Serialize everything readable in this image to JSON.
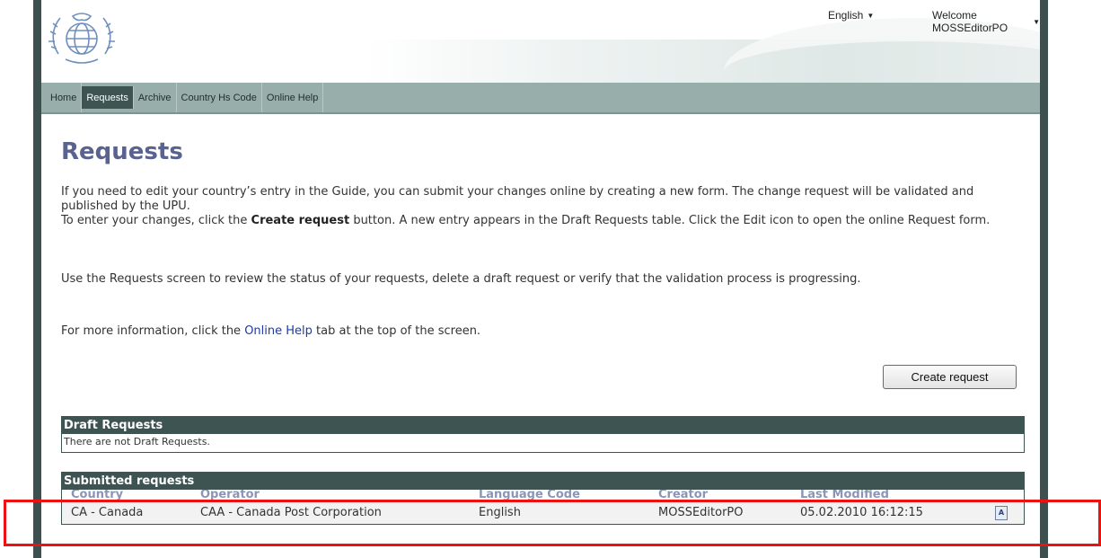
{
  "header": {
    "language": "English",
    "welcome": "Welcome MOSSEditorPO"
  },
  "nav": {
    "items": [
      {
        "label": "Home"
      },
      {
        "label": "Requests"
      },
      {
        "label": "Archive"
      },
      {
        "label": "Country Hs Code"
      },
      {
        "label": "Online Help"
      }
    ],
    "active": "Requests"
  },
  "page": {
    "title": "Requests",
    "para1_a": "If you need to edit your country’s entry in the Guide, you can submit your changes online by creating a new form. The change request will be validated and published by the UPU.",
    "para1_b_pre": "To enter your changes, click the ",
    "para1_b_bold": "Create request",
    "para1_b_post": " button. A new entry appears in the Draft Requests table. Click the Edit icon to open the online Request form.",
    "para2": "Use the Requests screen to review the status of your requests, delete a draft request or verify that the validation process is progressing.",
    "para3_pre": "For more information, click the ",
    "para3_link": "Online Help",
    "para3_post": " tab at the top of the screen.",
    "create_button": "Create request"
  },
  "draft": {
    "title": "Draft Requests",
    "empty_text": "There are not Draft Requests."
  },
  "submitted": {
    "title": "Submitted requests",
    "columns": [
      "Country",
      "Operator",
      "Language Code",
      "Creator",
      "Last Modified"
    ],
    "rows": [
      {
        "country": "CA - Canada",
        "operator": "CAA - Canada Post Corporation",
        "language": "English",
        "creator": "MOSSEditorPO",
        "modified": "05.02.2010 16:12:15",
        "icon": "pdf-document-icon"
      }
    ]
  },
  "colors": {
    "frame": "#3e4f50",
    "nav": "#98aeaa",
    "panel_header": "#3e5453",
    "title": "#5a6390",
    "highlight": "#ee1111"
  }
}
